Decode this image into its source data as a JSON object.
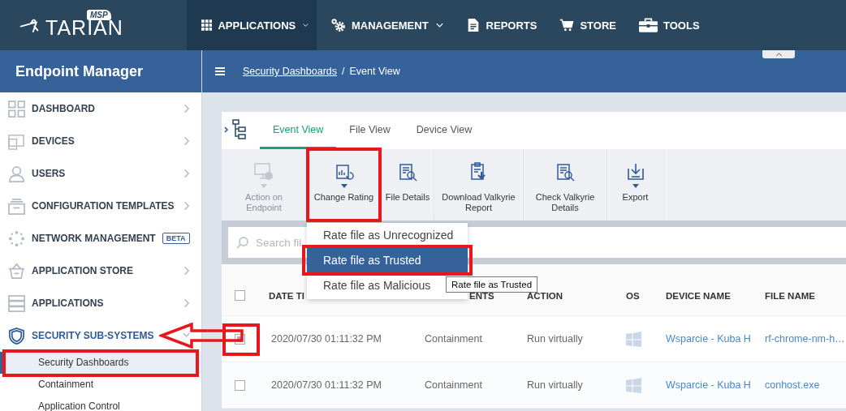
{
  "logo": {
    "name": "TARIAN",
    "badge": "MSP"
  },
  "top_nav": [
    {
      "label": "APPLICATIONS",
      "kind": "grid",
      "selected": true,
      "dropdown": true
    },
    {
      "label": "MANAGEMENT",
      "kind": "gears",
      "selected": false,
      "dropdown": true
    },
    {
      "label": "REPORTS",
      "kind": "document",
      "selected": false,
      "dropdown": false
    },
    {
      "label": "STORE",
      "kind": "cart",
      "selected": false,
      "dropdown": false
    },
    {
      "label": "TOOLS",
      "kind": "toolbox",
      "selected": false,
      "dropdown": false
    }
  ],
  "sidebar": {
    "title": "Endpoint Manager",
    "items": [
      {
        "label": "DASHBOARD",
        "kind": "dashboard",
        "expanded": false
      },
      {
        "label": "DEVICES",
        "kind": "devices",
        "expanded": false
      },
      {
        "label": "USERS",
        "kind": "users",
        "expanded": false
      },
      {
        "label": "CONFIGURATION TEMPLATES",
        "kind": "templates",
        "expanded": false
      },
      {
        "label": "NETWORK MANAGEMENT",
        "kind": "network",
        "expanded": false,
        "badge": "BETA"
      },
      {
        "label": "APPLICATION STORE",
        "kind": "store",
        "expanded": false
      },
      {
        "label": "APPLICATIONS",
        "kind": "applications",
        "expanded": false
      },
      {
        "label": "SECURITY SUB-SYSTEMS",
        "kind": "shield",
        "expanded": true,
        "children": [
          {
            "label": "Security Dashboards",
            "selected": true
          },
          {
            "label": "Containment",
            "selected": false
          },
          {
            "label": "Application Control",
            "selected": false
          }
        ]
      }
    ]
  },
  "breadcrumb": {
    "link": "Security Dashboards",
    "separator": "/",
    "current": "Event View"
  },
  "tabs": [
    {
      "label": "Event View",
      "selected": true
    },
    {
      "label": "File View",
      "selected": false
    },
    {
      "label": "Device View",
      "selected": false
    }
  ],
  "toolbar": [
    {
      "label": "Action on Endpoint",
      "kind": "endpoint",
      "disabled": true,
      "dropdown": true
    },
    {
      "label": "Change Rating",
      "kind": "rating",
      "disabled": false,
      "dropdown": true
    },
    {
      "label": "File Details",
      "kind": "details",
      "disabled": false,
      "dropdown": false
    },
    {
      "label": "Download Valkyrie Report",
      "kind": "download",
      "disabled": false,
      "dropdown": false
    },
    {
      "label": "Check Valkyrie Details",
      "kind": "details",
      "disabled": false,
      "dropdown": false
    },
    {
      "label": "Export",
      "kind": "export",
      "disabled": false,
      "dropdown": true
    }
  ],
  "search": {
    "placeholder": "Search fil"
  },
  "rating_menu": {
    "items": [
      {
        "label": "Rate file as Unrecognized",
        "selected": false
      },
      {
        "label": "Rate file as Trusted",
        "selected": true
      },
      {
        "label": "Rate file as Malicious",
        "selected": false
      }
    ],
    "tooltip": "Rate file as Trusted"
  },
  "table": {
    "header_checked": false,
    "columns": [
      "DATE TI",
      "ENTS",
      "ACTION",
      "OS",
      "DEVICE NAME",
      "FILE NAME"
    ],
    "rows": [
      {
        "checked": true,
        "date": "2020/07/30 01:11:32 PM",
        "event": "Containment",
        "action": "Run virtually",
        "kind": "windows",
        "device": "Wsparcie - Kuba H",
        "file": "rf-chrome-nm-h…"
      },
      {
        "checked": false,
        "date": "2020/07/30 01:11:32 PM",
        "event": "Containment",
        "action": "Run virtually",
        "kind": "windows",
        "device": "Wsparcie - Kuba H",
        "file": "conhost.exe"
      }
    ]
  }
}
